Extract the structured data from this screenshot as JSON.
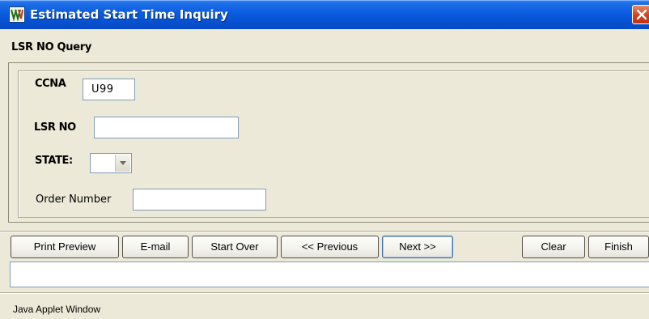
{
  "window": {
    "title": "Estimated Start Time Inquiry",
    "icon": "java-applet-icon",
    "close_icon": "close-icon"
  },
  "section": {
    "title": "LSR NO Query"
  },
  "form": {
    "ccna_label": "CCNA",
    "ccna_value": "U99",
    "lsr_no_label": "LSR NO",
    "lsr_no_value": "",
    "state_label": "STATE:",
    "state_value": "",
    "order_number_label": "Order Number",
    "order_number_value": ""
  },
  "buttons": {
    "print_preview": "Print Preview",
    "email": "E-mail",
    "start_over": "Start Over",
    "previous": "<< Previous",
    "next": "Next >>",
    "clear": "Clear",
    "finish": "Finish"
  },
  "message_bar": {
    "text": ""
  },
  "status": {
    "text": "Java Applet Window"
  },
  "colors": {
    "titlebar": "#0a5ce0",
    "background": "#ece9d8",
    "close_button": "#d2401c",
    "field_border": "#7f9db9"
  }
}
